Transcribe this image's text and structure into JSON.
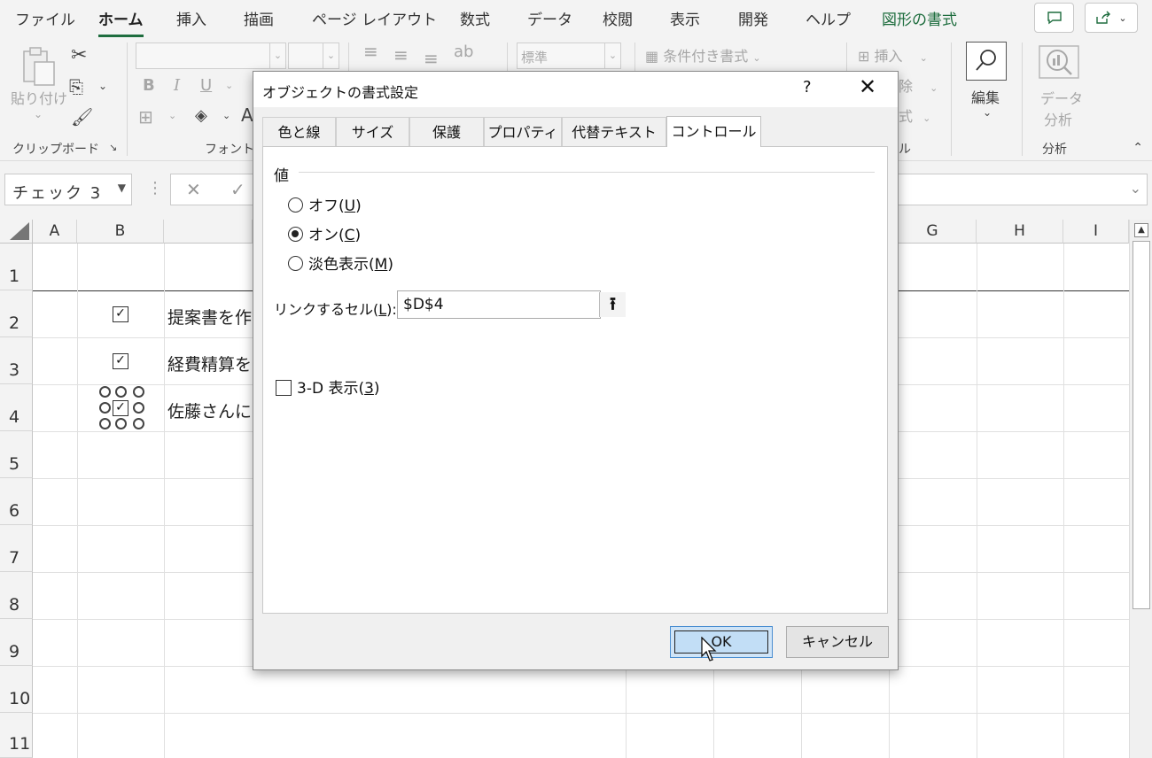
{
  "menu": {
    "tabs": [
      "ファイル",
      "ホーム",
      "挿入",
      "描画",
      "ページ レイアウト",
      "数式",
      "データ",
      "校閲",
      "表示",
      "開発",
      "ヘルプ",
      "図形の書式"
    ],
    "active_tab": "ホーム",
    "accent_color": "#1e6d3e"
  },
  "ribbon": {
    "paste_label": "貼り付け",
    "font_style": {
      "bold": "B",
      "italic": "I",
      "underline": "U"
    },
    "number_format": "標準",
    "conditional_format": "条件付き書式",
    "insert": "挿入",
    "delete": "除",
    "format": "式",
    "edit_label": "編集",
    "data_analysis_label": [
      "データ",
      "分析"
    ],
    "groups": {
      "clipboard": "クリップボード",
      "font": "フォント",
      "cells": "ル",
      "analysis": "分析"
    }
  },
  "formula_bar": {
    "name_box": "チェック 3",
    "formula": ""
  },
  "sheet": {
    "columns": [
      "A",
      "B",
      "",
      "",
      "",
      "",
      "G",
      "H",
      "I"
    ],
    "rows": [
      "1",
      "2",
      "3",
      "4",
      "5",
      "6",
      "7",
      "8",
      "9",
      "10",
      "11"
    ],
    "cells": [
      {
        "row": "2",
        "checked": true,
        "text": "提案書を作"
      },
      {
        "row": "3",
        "checked": true,
        "text": "経費精算を"
      },
      {
        "row": "4",
        "checked": true,
        "text": "佐藤さんに"
      }
    ]
  },
  "dialog": {
    "title": "オブジェクトの書式設定",
    "help": "?",
    "close": "✕",
    "tabs": [
      "色と線",
      "サイズ",
      "保護",
      "プロパティ",
      "代替テキスト",
      "コントロール"
    ],
    "active_tab": "コントロール",
    "value_section": "値",
    "radios": [
      {
        "label": "オフ(",
        "key": "U",
        "suffix": ")",
        "selected": false
      },
      {
        "label": "オン(",
        "key": "C",
        "suffix": ")",
        "selected": true
      },
      {
        "label": "淡色表示(",
        "key": "M",
        "suffix": ")",
        "selected": false
      }
    ],
    "link_cell": {
      "label_prefix": "リンクするセル(",
      "label_key": "L",
      "label_suffix": "):",
      "value": "$D$4"
    },
    "three_d": {
      "label_prefix": "3-D 表示(",
      "label_key": "3",
      "label_suffix": ")",
      "checked": false
    },
    "ok_label": "OK",
    "cancel_label": "キャンセル"
  }
}
